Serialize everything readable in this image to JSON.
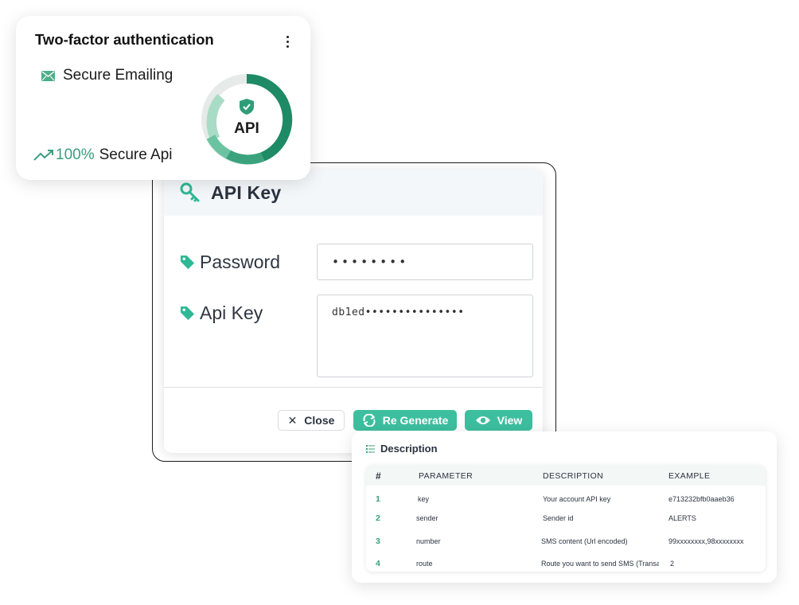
{
  "two_factor": {
    "title": "Two-factor authentication",
    "email_label": "Secure Emailing",
    "api_percent": "100%",
    "api_label": "Secure Api",
    "donut_label": "API",
    "colors": {
      "accent": "#1e8a66",
      "accent_light": "#8cd1b6",
      "track": "#e6eae9"
    }
  },
  "api_key_modal": {
    "title": "API Key",
    "password_label": "Password",
    "password_value": "••••••••",
    "api_key_label": "Api Key",
    "api_key_value": "db1ed•••••••••••••••",
    "buttons": {
      "close": "Close",
      "regenerate": "Re Generate",
      "view": "View"
    },
    "colors": {
      "button": "#3dbf9f",
      "icon": "#2fb896"
    }
  },
  "description": {
    "title": "Description",
    "columns": [
      "#",
      "PARAMETER",
      "DESCRIPTION",
      "EXAMPLE"
    ],
    "rows": [
      {
        "num": "1",
        "parameter": "key",
        "description": "Your account API key",
        "example": "e713232bfb0aaeb36"
      },
      {
        "num": "2",
        "parameter": "sender",
        "description": "Sender id",
        "example": "ALERTS"
      },
      {
        "num": "3",
        "parameter": "number",
        "description": "SMS content (Url encoded)",
        "example": "99xxxxxxxx,98xxxxxxxx"
      },
      {
        "num": "4",
        "parameter": "route",
        "description": "Route you want to send SMS (Transa",
        "example": "2"
      }
    ]
  }
}
